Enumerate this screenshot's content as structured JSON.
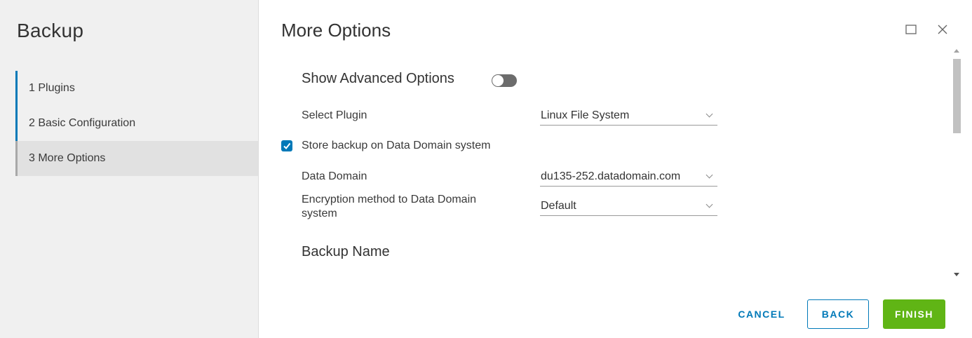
{
  "sidebar": {
    "title": "Backup",
    "steps": [
      {
        "label": "1 Plugins"
      },
      {
        "label": "2 Basic Configuration"
      },
      {
        "label": "3 More Options"
      }
    ]
  },
  "main": {
    "title": "More Options",
    "advanced_options_label": "Show Advanced Options",
    "advanced_options_enabled": false,
    "select_plugin": {
      "label": "Select Plugin",
      "value": "Linux File System"
    },
    "store_on_dd": {
      "label": "Store backup on Data Domain system",
      "checked": true
    },
    "data_domain": {
      "label": "Data Domain",
      "value": "du135-252.datadomain.com"
    },
    "encryption": {
      "label_line1": "Encryption method to Data Domain",
      "label_line2": "system",
      "value": "Default"
    },
    "backup_name_heading": "Backup Name"
  },
  "footer": {
    "cancel_label": "CANCEL",
    "back_label": "BACK",
    "finish_label": "FINISH"
  },
  "icons": {
    "maximize": "maximize-icon",
    "close": "close-icon",
    "check": "checkmark-icon",
    "chevron": "chevron-down-icon"
  },
  "colors": {
    "accent": "#0079b8",
    "finish": "#60b515",
    "toggle_off": "#6c6c6c",
    "sidebar_bg": "#f0f0f0"
  }
}
